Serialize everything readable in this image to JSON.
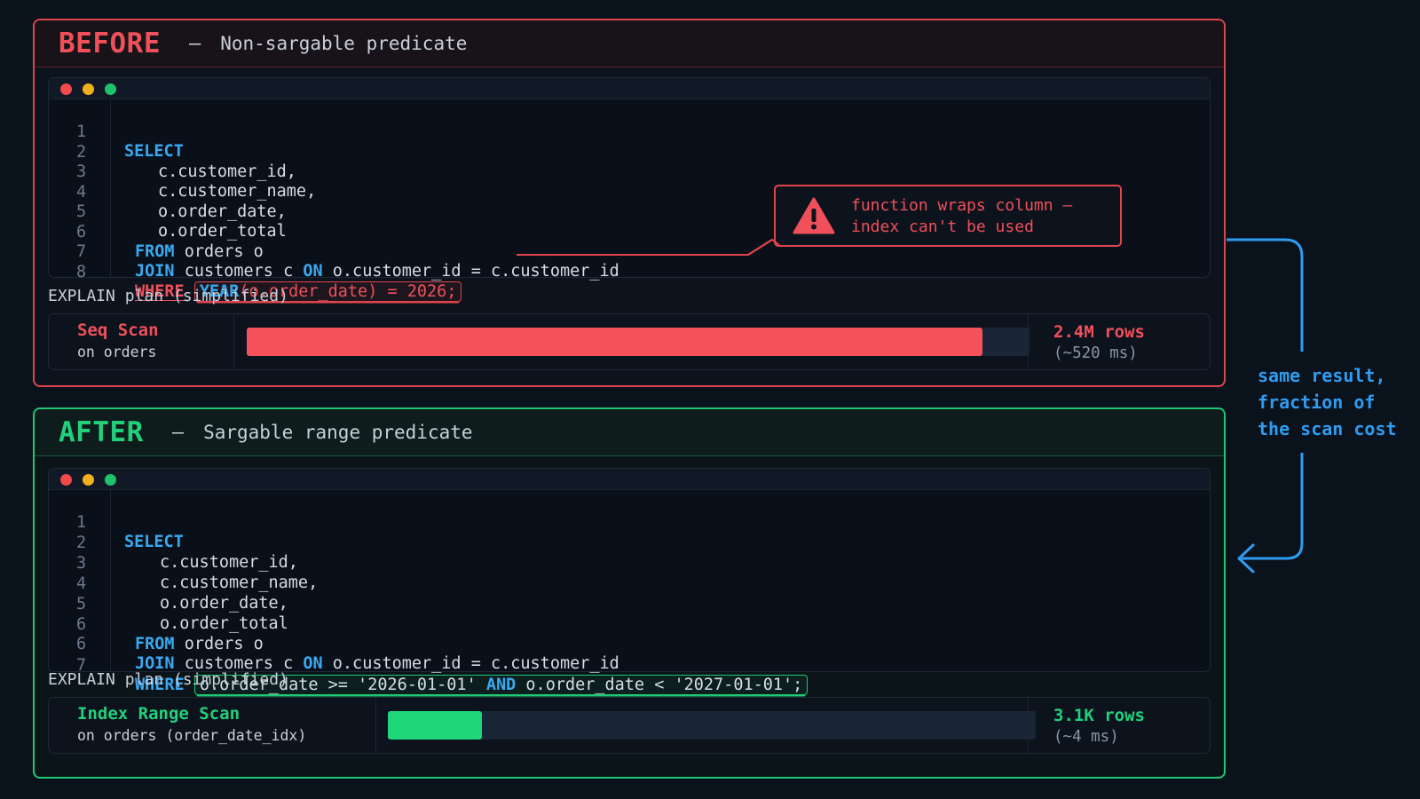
{
  "before": {
    "title": "BEFORE",
    "dash": "–",
    "subtitle": "Non-sargable predicate",
    "lines": [
      {
        "num": "1",
        "kw": "SELECT",
        "text": ""
      },
      {
        "num": "2",
        "text": "c.customer_id,"
      },
      {
        "num": "3",
        "text": "c.customer_name,"
      },
      {
        "num": "4",
        "text": "o.order_date,"
      },
      {
        "num": "5",
        "text": "o.order_total"
      },
      {
        "num": "6",
        "kw": "FROM",
        "text": " orders o"
      },
      {
        "num": "7",
        "kw": "JOIN",
        "text": " customers c ",
        "kw2": "ON",
        "text2": " o.customer_id = c.customer_id"
      },
      {
        "num": "8",
        "kw": "WHERE",
        "hl_kw": "YEAR",
        "hl_text": "(o.order_date) = 2026;"
      }
    ],
    "callout": "function wraps column –\nindex can't be used",
    "explain_label": "EXPLAIN plan (simplified)",
    "plan": {
      "operation": "Seq Scan",
      "target": "on orders",
      "rows": "2.4M rows",
      "time": "(~520 ms)",
      "bar_fraction": 0.94
    }
  },
  "after": {
    "title": "AFTER",
    "dash": "–",
    "subtitle": "Sargable range predicate",
    "lines": [
      {
        "num": "1",
        "kw": "SELECT",
        "text": ""
      },
      {
        "num": "2",
        "text": "c.customer_id,"
      },
      {
        "num": "3",
        "text": "c.customer_name,"
      },
      {
        "num": "4",
        "text": "o.order_date,"
      },
      {
        "num": "5",
        "text": "o.order_total"
      },
      {
        "num": "6",
        "kw": "FROM",
        "text": " orders o"
      },
      {
        "num": "6",
        "kw": "JOIN",
        "text": " customers c ",
        "kw2": "ON",
        "text2": " o.customer_id = c.customer_id"
      },
      {
        "num": "7",
        "kw": "WHERE",
        "hl_a": "o.order_date >= '2026-01-01' ",
        "hl_kw": "AND",
        "hl_b": " o.order_date < '2027-01-01';"
      }
    ],
    "explain_label": "EXPLAIN plan (simplified)",
    "plan": {
      "operation": "Index Range Scan",
      "target": "on orders (order_date_idx)",
      "rows": "3.1K rows",
      "time": "(~4 ms)",
      "bar_fraction": 0.145
    }
  },
  "side_note": "same result,\nfraction of\nthe scan cost",
  "colors": {
    "red": "#f0505a",
    "green": "#22d07c",
    "blue": "#2f9cf0",
    "keyword": "#3aa8f0"
  }
}
